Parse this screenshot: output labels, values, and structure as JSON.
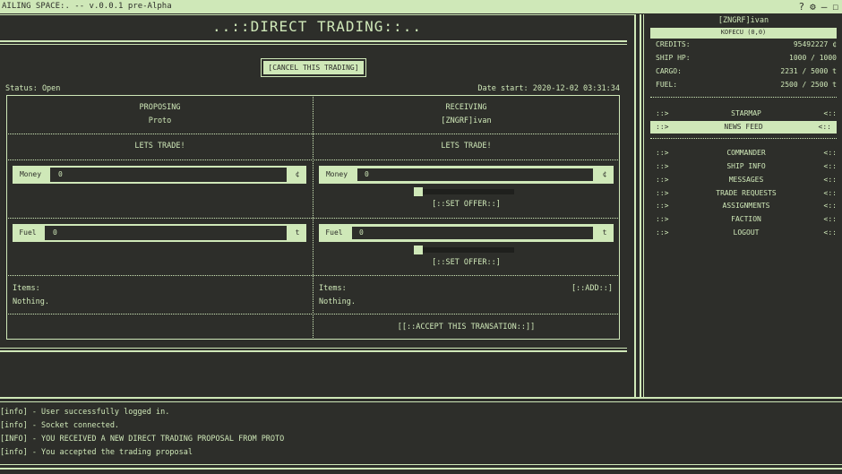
{
  "window": {
    "title": "AILING SPACE:. -- v.0.0.1 pre-Alpha",
    "icons": [
      "help-icon",
      "gear-icon",
      "minimize-icon",
      "maximize-icon"
    ]
  },
  "main": {
    "heading": "..::DIRECT TRADING::..",
    "cancel_label": "[CANCEL THIS TRADING]",
    "status": "Status: Open",
    "date_start": "Date start: 2020-12-02 03:31:34",
    "left": {
      "role": "PROPOSING",
      "name": "Proto",
      "message": "LETS TRADE!",
      "money_label": "Money",
      "money_value": "0",
      "money_unit": "¢",
      "fuel_label": "Fuel",
      "fuel_value": "0",
      "fuel_unit": "t",
      "items_label": "Items:",
      "items_value": "Nothing."
    },
    "right": {
      "role": "RECEIVING",
      "name": "[ZNGRF]ivan",
      "message": "LETS TRADE!",
      "money_label": "Money",
      "money_value": "0",
      "money_unit": "¢",
      "set_offer_money": "[::SET OFFER::]",
      "fuel_label": "Fuel",
      "fuel_value": "0",
      "fuel_unit": "t",
      "set_offer_fuel": "[::SET OFFER::]",
      "items_label": "Items:",
      "add_label": "[::ADD::]",
      "items_value": "Nothing.",
      "accept_label": "[[::ACCEPT THIS TRANSATION::]]"
    }
  },
  "sidebar": {
    "player": "[ZNGRF]ivan",
    "location": "KOFECU (0,0)",
    "stats": [
      {
        "key": "CREDITS:",
        "value": "95492227 ¢"
      },
      {
        "key": "SHIP HP:",
        "value": "1000 / 1000"
      },
      {
        "key": "CARGO:",
        "value": "2231 / 5000 t"
      },
      {
        "key": "FUEL:",
        "value": "2500 / 2500 t"
      }
    ],
    "arrow_left": "::>",
    "arrow_right": "<::",
    "nav_top": [
      "STARMAP",
      "NEWS FEED"
    ],
    "nav_main": [
      "COMMANDER",
      "SHIP INFO",
      "MESSAGES",
      "TRADE REQUESTS",
      "ASSIGNMENTS",
      "FACTION",
      "LOGOUT"
    ]
  },
  "log": [
    "[info] - User successfully logged in.",
    "[info] - Socket connected.",
    "[INFO] - YOU RECEIVED A NEW DIRECT TRADING PROPOSAL FROM PROTO",
    "[info] - You accepted the trading proposal"
  ]
}
